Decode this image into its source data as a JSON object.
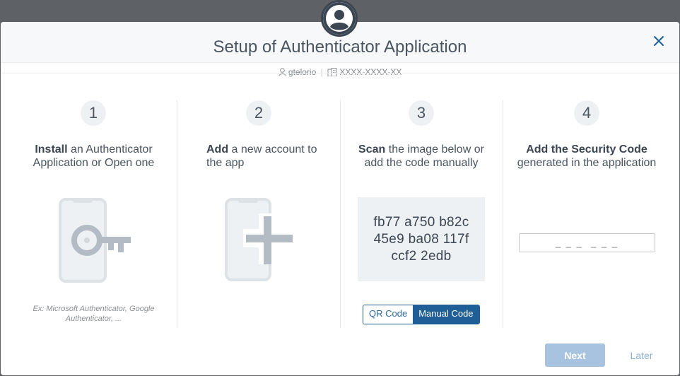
{
  "dialog": {
    "title": "Setup of Authenticator Application",
    "user": "gtelorio",
    "account": "XXXX-XXXX-XX"
  },
  "steps": [
    {
      "number": "1",
      "bold": "Install",
      "rest": " an Authenticator Application or Open one",
      "hint": "Ex: Microsoft Authenticator, Google Authenticator, ..."
    },
    {
      "number": "2",
      "bold": "Add",
      "rest": " a new account to the app"
    },
    {
      "number": "3",
      "bold": "Scan",
      "rest": " the image below or add the code manually",
      "code_lines": [
        "fb77 a750 b82c",
        "45e9 ba08 117f",
        "ccf2 2edb"
      ],
      "toggle": {
        "qr_label": "QR Code",
        "manual_label": "Manual Code",
        "selected": "Manual Code"
      }
    },
    {
      "number": "4",
      "bold": "Add the Security Code",
      "rest": " generated in the application",
      "input_placeholder": "_ _ _  _ _ _"
    }
  ],
  "footer": {
    "next_label": "Next",
    "later_label": "Later"
  },
  "colors": {
    "accent": "#1f5e96",
    "next_disabled": "#a7c3df",
    "icon_gray": "#b9c0c7",
    "icon_bg": "#e6e9ec"
  },
  "icons": [
    "user-avatar-icon",
    "close-icon",
    "user-icon",
    "building-icon",
    "phone-key-icon",
    "phone-plus-icon"
  ]
}
